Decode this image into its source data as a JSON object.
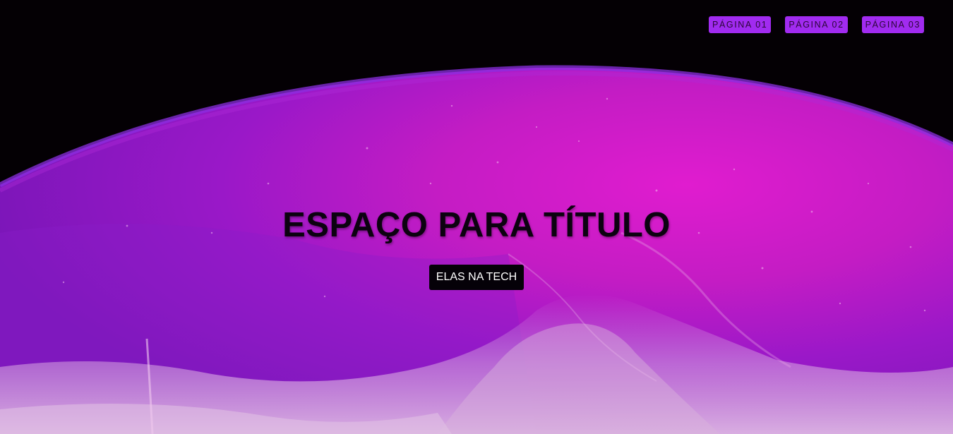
{
  "nav": {
    "items": [
      {
        "label": "PÁGINA 01"
      },
      {
        "label": "PÁGINA 02"
      },
      {
        "label": "PÁGINA 03"
      }
    ]
  },
  "hero": {
    "title": "ESPAÇO PARA TÍTULO",
    "button_label": "ELAS NA TECH"
  },
  "colors": {
    "background": "#040004",
    "nav_button": "#a12bf0",
    "planet_primary": "#d21cc8",
    "planet_secondary": "#9a1ad0",
    "cta_background": "#050108"
  }
}
